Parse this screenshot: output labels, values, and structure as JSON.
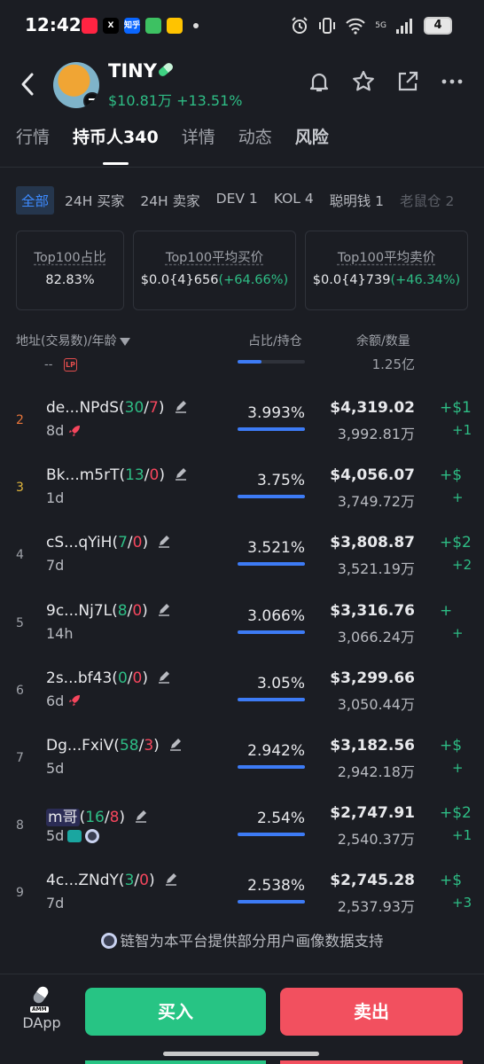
{
  "status_bar": {
    "time": "12:42",
    "battery": "4",
    "network_label": "5G",
    "app_icons": [
      {
        "name": "rednote-app-icon",
        "label": "",
        "color": "#ff2442"
      },
      {
        "name": "x-app-icon",
        "label": "X",
        "color": "#000000"
      },
      {
        "name": "zhihu-app-icon",
        "label": "知乎",
        "color": "#0a66ff"
      },
      {
        "name": "wechat-app-icon",
        "label": "",
        "color": "#3dc162"
      },
      {
        "name": "meituan-app-icon",
        "label": "",
        "color": "#ffc300"
      }
    ]
  },
  "header": {
    "token_name": "TINY",
    "price_line": "$10.81万 +13.51%"
  },
  "tabs": [
    "行情",
    "持币人340",
    "详情",
    "动态",
    "风险"
  ],
  "filters": [
    "全部",
    "24H 买家",
    "24H 卖家",
    "DEV 1",
    "KOL 4",
    "聪明钱 1",
    "老鼠仓 2"
  ],
  "stats": [
    {
      "label": "Top100占比",
      "value": "82.83%",
      "change": ""
    },
    {
      "label": "Top100平均买价",
      "value": "$0.0{4}656",
      "change": "(+64.66%)"
    },
    {
      "label": "Top100平均卖价",
      "value": "$0.0{4}739",
      "change": "(+46.34%)"
    }
  ],
  "table_header": {
    "col_address": "地址(交易数)/年龄",
    "col_share": "占比/持仓",
    "col_balance": "余额/数量"
  },
  "partial_row": {
    "dash": "--",
    "badge": "LP",
    "amount": "1.25亿",
    "fill": 0.36
  },
  "rows": [
    {
      "rank": "2",
      "name": "de...NPdS",
      "buys": "30",
      "sep": "/",
      "sells": "7",
      "age": "8d",
      "badges": [
        "rocket"
      ],
      "pct": "3.993%",
      "usd": "$4,319.02",
      "qty": "3,992.81万",
      "edge1": "+$1",
      "edge2": "+1"
    },
    {
      "rank": "3",
      "name": "Bk...m5rT",
      "buys": "13",
      "sep": "/",
      "sells": "0",
      "age": "1d",
      "badges": [],
      "pct": "3.75%",
      "usd": "$4,056.07",
      "qty": "3,749.72万",
      "edge1": "+$",
      "edge2": "+"
    },
    {
      "rank": "4",
      "name": "cS...qYiH",
      "buys": "7",
      "sep": "/",
      "sells": "0",
      "age": "7d",
      "badges": [],
      "pct": "3.521%",
      "usd": "$3,808.87",
      "qty": "3,521.19万",
      "edge1": "+$2",
      "edge2": "+2"
    },
    {
      "rank": "5",
      "name": "9c...Nj7L",
      "buys": "8",
      "sep": "/",
      "sells": "0",
      "age": "14h",
      "badges": [],
      "pct": "3.066%",
      "usd": "$3,316.76",
      "qty": "3,066.24万",
      "edge1": "+",
      "edge2": "+"
    },
    {
      "rank": "6",
      "name": "2s...bf43",
      "buys": "0",
      "sep": "/",
      "sells": "0",
      "age": "6d",
      "badges": [
        "rocket"
      ],
      "pct": "3.05%",
      "usd": "$3,299.66",
      "qty": "3,050.44万",
      "edge1": "",
      "edge2": ""
    },
    {
      "rank": "7",
      "name": "Dg...FxiV",
      "buys": "58",
      "sep": "/",
      "sells": "3",
      "age": "5d",
      "badges": [],
      "pct": "2.942%",
      "usd": "$3,182.56",
      "qty": "2,942.18万",
      "edge1": "+$",
      "edge2": "+"
    },
    {
      "rank": "8",
      "name": "m哥",
      "buys": "16",
      "sep": "/",
      "sells": "8",
      "age": "5d",
      "badges": [
        "tag",
        "ring"
      ],
      "pct": "2.54%",
      "usd": "$2,747.91",
      "qty": "2,540.37万",
      "edge1": "+$2",
      "edge2": "+1"
    },
    {
      "rank": "9",
      "name": "4c...ZNdY",
      "buys": "3",
      "sep": "/",
      "sells": "0",
      "age": "7d",
      "badges": [],
      "pct": "2.538%",
      "usd": "$2,745.28",
      "qty": "2,537.93万",
      "edge1": "+$",
      "edge2": "+3"
    }
  ],
  "footer_note": "链智为本平台提供部分用户画像数据支持",
  "bottom_bar": {
    "dapp_label": "DApp",
    "amm_label": "AMM",
    "buy_label": "买入",
    "sell_label": "卖出"
  },
  "colors": {
    "background": "#1b1d23",
    "positive": "#2ebd85",
    "negative": "#f6465d",
    "accent": "#3d8bff",
    "buy_button": "#27c484",
    "sell_button": "#f2505f"
  }
}
